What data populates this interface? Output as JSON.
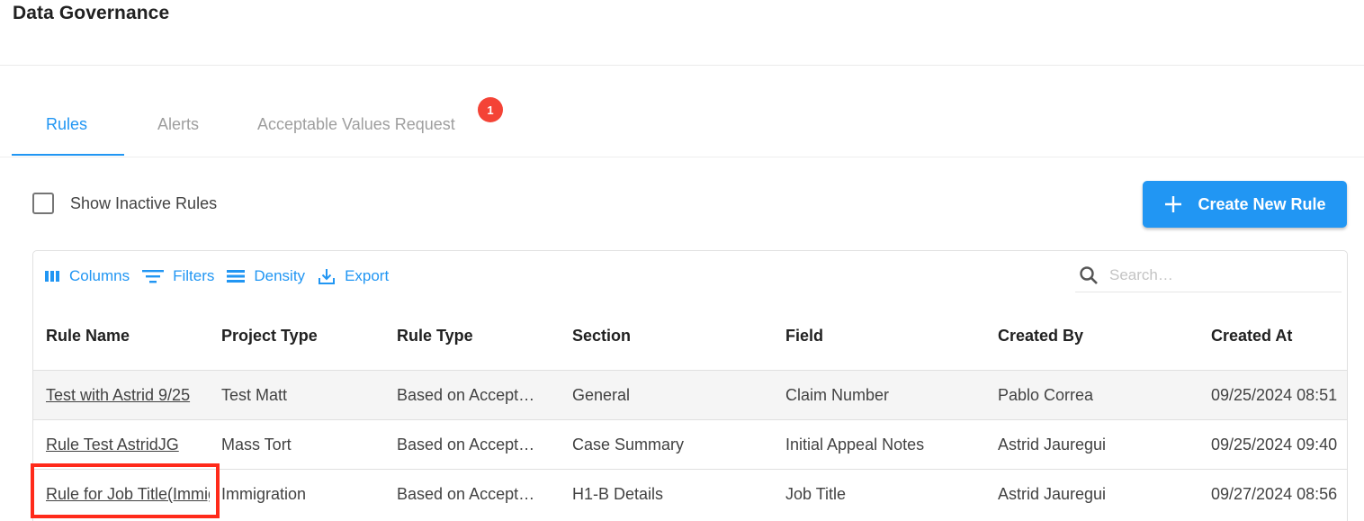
{
  "page": {
    "title": "Data Governance"
  },
  "tabs": [
    {
      "label": "Rules",
      "active": true
    },
    {
      "label": "Alerts",
      "active": false
    },
    {
      "label": "Acceptable Values Request",
      "active": false,
      "badge": "1"
    }
  ],
  "controls": {
    "show_inactive_label": "Show Inactive Rules",
    "show_inactive_checked": false,
    "create_button_label": "Create New Rule"
  },
  "toolbar": {
    "columns_label": "Columns",
    "filters_label": "Filters",
    "density_label": "Density",
    "export_label": "Export",
    "search_placeholder": "Search…"
  },
  "table": {
    "headers": [
      "Rule Name",
      "Project Type",
      "Rule Type",
      "Section",
      "Field",
      "Created By",
      "Created At"
    ],
    "rows": [
      [
        "Test with Astrid 9/25",
        "Test Matt",
        "Based on Accept…",
        "General",
        "Claim Number",
        "Pablo Correa",
        "09/25/2024 08:51"
      ],
      [
        "Rule Test AstridJG",
        "Mass Tort",
        "Based on Accept…",
        "Case Summary",
        "Initial Appeal Notes",
        "Astrid Jauregui",
        "09/25/2024 09:40"
      ],
      [
        "Rule for Job Title(Immigration)",
        "Immigration",
        "Based on Accept…",
        "H1-B Details",
        "Job Title",
        "Astrid Jauregui",
        "09/27/2024 08:56"
      ]
    ]
  },
  "colors": {
    "accent": "#2196f3",
    "badge": "#f44336",
    "highlight": "#ff2a1a"
  }
}
